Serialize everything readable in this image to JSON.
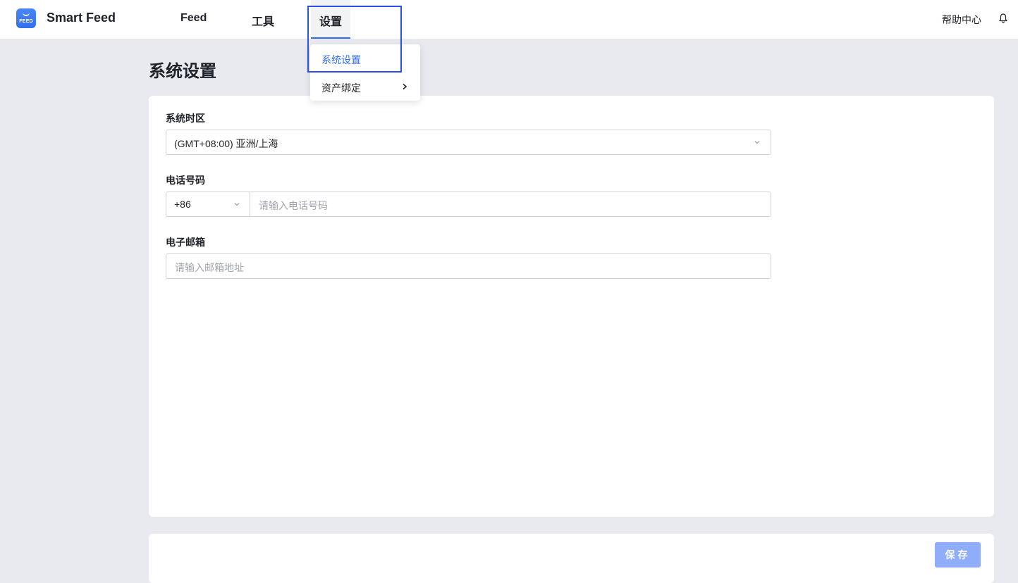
{
  "app": {
    "logo_text": "FEED",
    "title": "Smart Feed"
  },
  "nav": {
    "items": [
      {
        "label": "Feed"
      },
      {
        "label": "工具"
      },
      {
        "label": "设置"
      }
    ],
    "active_index": 2,
    "help_label": "帮助中心",
    "bell_icon": "bell-icon"
  },
  "dropdown": {
    "items": [
      {
        "label": "系统设置",
        "active": true
      },
      {
        "label": "资产绑定",
        "has_submenu": true
      }
    ]
  },
  "page": {
    "title": "系统设置"
  },
  "form": {
    "timezone": {
      "label": "系统时区",
      "value": "(GMT+08:00) 亚洲/上海"
    },
    "phone": {
      "label": "电话号码",
      "code": "+86",
      "placeholder": "请输入电话号码"
    },
    "email": {
      "label": "电子邮箱",
      "placeholder": "请输入邮箱地址"
    }
  },
  "footer": {
    "save_label": "保存"
  },
  "colors": {
    "accent": "#2f6bf5",
    "save_button_disabled": "#8fadf8",
    "page_background": "#e8eaf0",
    "highlight_box": "#2b52e8"
  }
}
